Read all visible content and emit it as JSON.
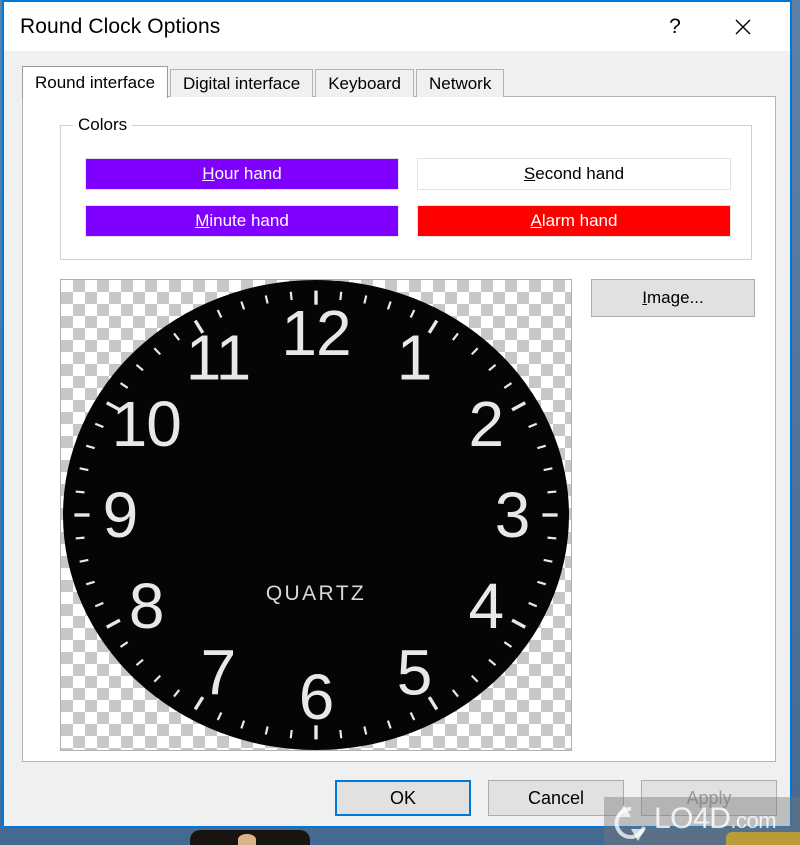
{
  "window": {
    "title": "Round Clock Options",
    "help_button": "?",
    "close_button": "×"
  },
  "tabs": [
    {
      "label": "Round interface",
      "active": true
    },
    {
      "label": "Digital interface",
      "active": false
    },
    {
      "label": "Keyboard",
      "active": false
    },
    {
      "label": "Network",
      "active": false
    }
  ],
  "colors_group": {
    "legend": "Colors",
    "buttons": [
      {
        "id": "hour",
        "accel": "H",
        "rest": "our hand",
        "label": "Hour hand",
        "color": "#7F00FF",
        "text_color": "#ffffff"
      },
      {
        "id": "minute",
        "accel": "M",
        "rest": "inute hand",
        "label": "Minute hand",
        "color": "#7F00FF",
        "text_color": "#ffffff"
      },
      {
        "id": "second",
        "accel": "S",
        "rest": "econd hand",
        "label": "Second hand",
        "color": "#FFFFFF",
        "text_color": "#000000"
      },
      {
        "id": "alarm",
        "accel": "A",
        "rest": "larm hand",
        "label": "Alarm hand",
        "color": "#FF0000",
        "text_color": "#ffffff"
      }
    ]
  },
  "preview": {
    "background": "transparency-checkerboard",
    "clock": {
      "face_color": "#050505",
      "mark_color": "#e8e8e8",
      "brand_text": "QUARTZ",
      "numerals": [
        "1",
        "2",
        "3",
        "4",
        "5",
        "6",
        "7",
        "8",
        "9",
        "10",
        "11",
        "12"
      ],
      "minute_ticks": 60
    }
  },
  "image_button": {
    "accel": "I",
    "rest": "mage...",
    "label": "Image..."
  },
  "footer": {
    "ok": "OK",
    "cancel": "Cancel",
    "apply": "Apply",
    "apply_disabled": true,
    "default_button": "OK"
  },
  "watermark": {
    "name": "LO4D",
    "suffix": ".com"
  }
}
